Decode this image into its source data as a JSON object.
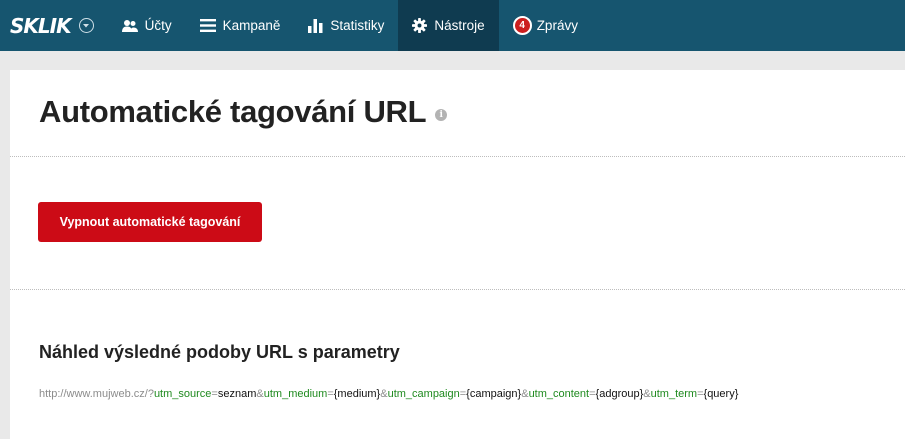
{
  "nav": {
    "logo": "SKLIK",
    "items": [
      {
        "label": "Účty",
        "icon": "users-icon"
      },
      {
        "label": "Kampaně",
        "icon": "menu-icon"
      },
      {
        "label": "Statistiky",
        "icon": "bar-chart-icon"
      },
      {
        "label": "Nástroje",
        "icon": "gear-icon",
        "active": true
      },
      {
        "label": "Zprávy",
        "icon": "messages-badge",
        "badge": "4"
      }
    ]
  },
  "page": {
    "title": "Automatické tagování URL",
    "button_label": "Vypnout automatické tagování",
    "section_title": "Náhled výsledné podoby URL s parametry"
  },
  "url": {
    "base": "http://www.mujweb.cz/?",
    "parts": [
      {
        "param": "utm_source",
        "value": "seznam"
      },
      {
        "param": "utm_medium",
        "value": "{medium}"
      },
      {
        "param": "utm_campaign",
        "value": "{campaign}"
      },
      {
        "param": "utm_content",
        "value": "{adgroup}"
      },
      {
        "param": "utm_term",
        "value": "{query}"
      }
    ],
    "eq": "=",
    "amp": "&"
  },
  "colors": {
    "nav_bg": "#16556f",
    "nav_active_bg": "#0f3b50",
    "primary": "#cc0b16",
    "param_green": "#1f8a1f"
  }
}
